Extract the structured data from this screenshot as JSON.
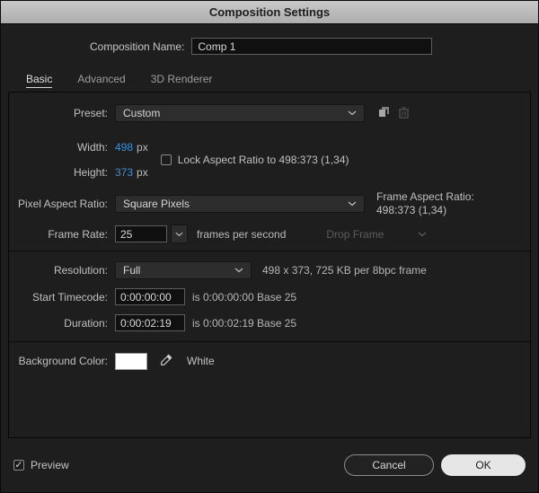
{
  "title": "Composition Settings",
  "name": {
    "label": "Composition Name:",
    "value": "Comp 1"
  },
  "tabs": {
    "basic": "Basic",
    "advanced": "Advanced",
    "renderer": "3D Renderer"
  },
  "preset": {
    "label": "Preset:",
    "value": "Custom"
  },
  "size": {
    "width_label": "Width:",
    "width_value": "498",
    "width_unit": "px",
    "height_label": "Height:",
    "height_value": "373",
    "height_unit": "px",
    "lock_label": "Lock Aspect Ratio to 498:373 (1,34)",
    "lock_checked": false
  },
  "pixel_aspect_ratio": {
    "label": "Pixel Aspect Ratio:",
    "value": "Square Pixels",
    "frame_aspect_label": "Frame Aspect Ratio:",
    "frame_aspect_value": "498:373 (1,34)"
  },
  "frame_rate": {
    "label": "Frame Rate:",
    "value": "25",
    "unit": "frames per second",
    "drop_frame_label": "Drop Frame"
  },
  "resolution": {
    "label": "Resolution:",
    "value": "Full",
    "info": "498 x 373, 725 KB per 8bpc frame"
  },
  "start_timecode": {
    "label": "Start Timecode:",
    "value": "0:00:00:00",
    "info": "is 0:00:00:00  Base 25"
  },
  "duration": {
    "label": "Duration:",
    "value": "0:00:02:19",
    "info": "is 0:00:02:19  Base 25"
  },
  "background": {
    "label": "Background Color:",
    "color_name": "White",
    "color_hex": "#ffffff"
  },
  "footer": {
    "preview_label": "Preview",
    "preview_checked": true,
    "cancel_label": "Cancel",
    "ok_label": "OK"
  },
  "icons": {
    "check": "✓"
  },
  "colors": {
    "accent_blue": "#3d90d7",
    "dialog_bg": "#1e1e1e"
  }
}
